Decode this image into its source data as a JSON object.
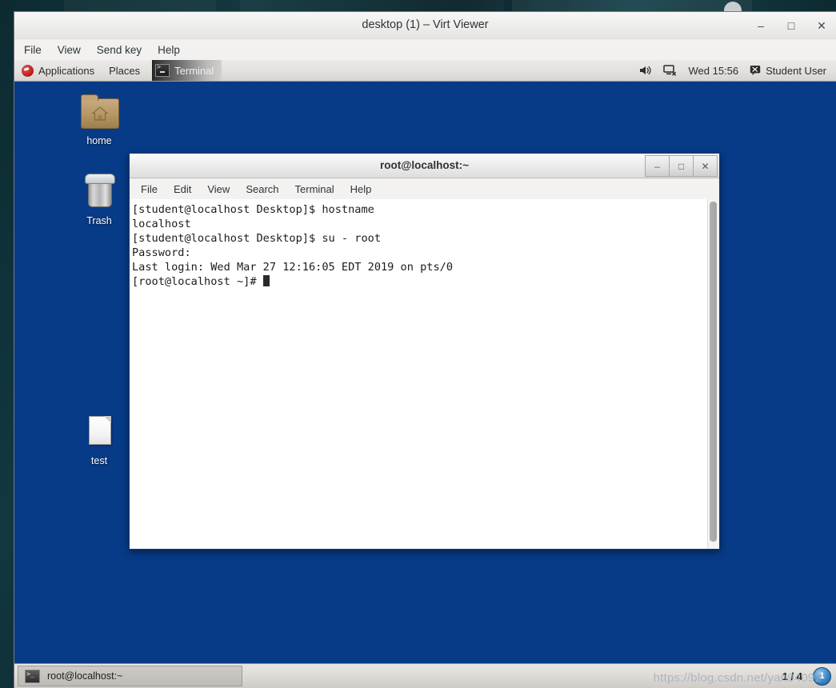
{
  "host_window": {
    "title": "desktop (1) – Virt Viewer",
    "menu": [
      {
        "label": "File"
      },
      {
        "label": "View"
      },
      {
        "label": "Send key"
      },
      {
        "label": "Help"
      }
    ],
    "window_buttons": {
      "minimize": "–",
      "maximize": "□",
      "close": "✕"
    }
  },
  "guest": {
    "top_panel": {
      "applications_label": "Applications",
      "places_label": "Places",
      "active_window_label": "Terminal",
      "clock": "Wed 15:56",
      "username": "Student User",
      "logo_icon": "fedora-logo-icon",
      "volume_icon": "speaker-icon",
      "network_icon": "network-disconnected-icon",
      "user_icon": "user-status-icon",
      "terminal_icon": "terminal-icon"
    },
    "desktop_icons": [
      {
        "label": "home",
        "icon": "home-folder-icon"
      },
      {
        "label": "Trash",
        "icon": "trash-icon"
      },
      {
        "label": "test",
        "icon": "document-icon"
      }
    ],
    "terminal_window": {
      "title": "root@localhost:~",
      "menu": [
        {
          "label": "File"
        },
        {
          "label": "Edit"
        },
        {
          "label": "View"
        },
        {
          "label": "Search"
        },
        {
          "label": "Terminal"
        },
        {
          "label": "Help"
        }
      ],
      "window_buttons": {
        "minimize": "–",
        "maximize": "□",
        "close": "✕"
      },
      "content": "[student@localhost Desktop]$ hostname\nlocalhost\n[student@localhost Desktop]$ su - root\nPassword:\nLast login: Wed Mar 27 12:16:05 EDT 2019 on pts/0\n[root@localhost ~]# "
    },
    "bottom_panel": {
      "taskbar_item_label": "root@localhost:~",
      "taskbar_item_icon": "terminal-icon",
      "workspace_indicator": "1 / 4",
      "notification_count": "1"
    },
    "watermark": "https://blog.csdn.net/yan94092"
  },
  "colors": {
    "desktop_blue": "#073b87",
    "host_background": "#12343c",
    "panel_gray": "#e3e1de",
    "terminal_border_blue": "#0f3f7a"
  }
}
